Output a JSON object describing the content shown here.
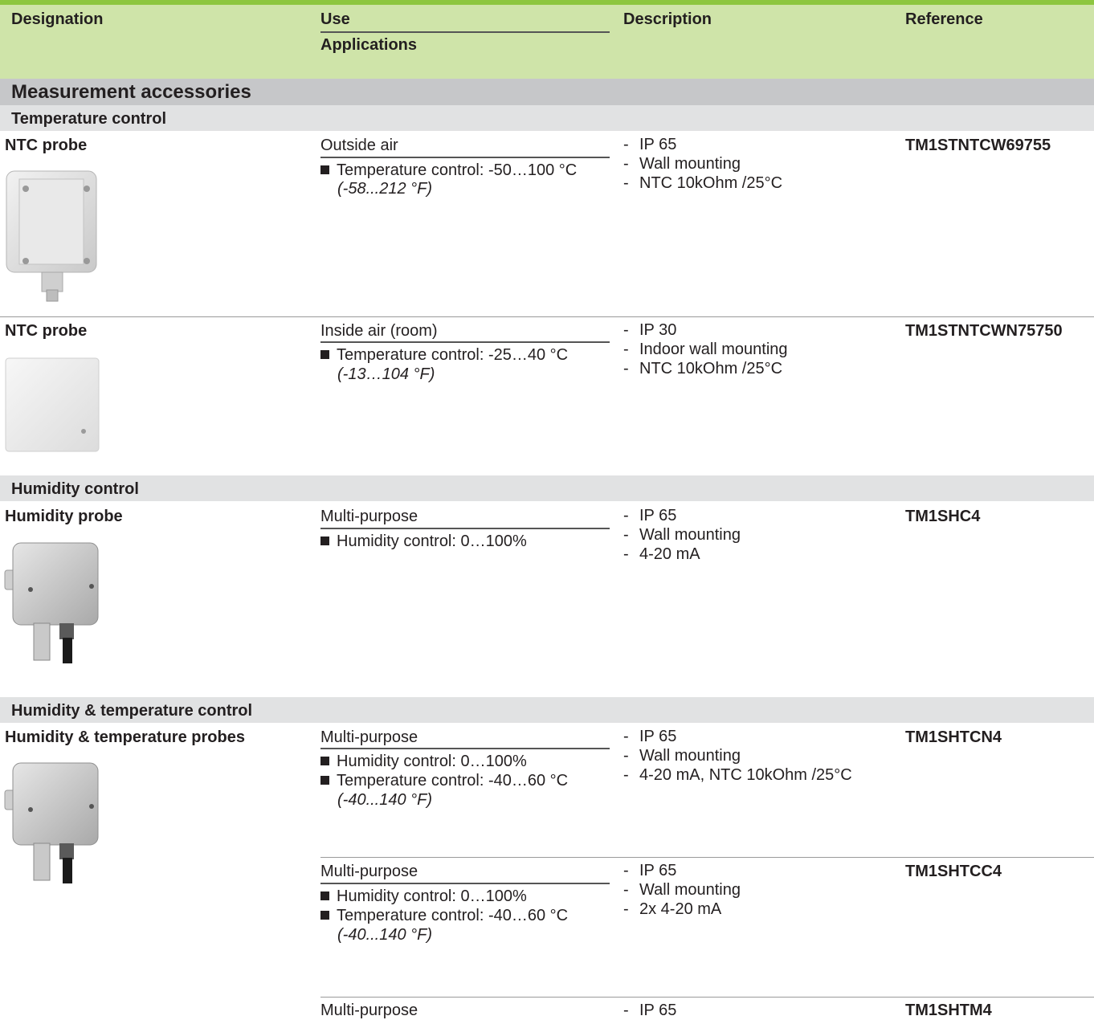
{
  "header": {
    "designation": "Designation",
    "use": "Use",
    "applications": "Applications",
    "description": "Description",
    "reference": "Reference"
  },
  "section": {
    "title": "Measurement accessories"
  },
  "groups": {
    "temperature": "Temperature control",
    "humidity": "Humidity control",
    "humtemp": "Humidity & temperature control"
  },
  "rows": [
    {
      "designation": "NTC probe",
      "use": "Outside air",
      "bullets": [
        "Temperature control: -50…100 °C"
      ],
      "italic": "(-58...212 °F)",
      "desc": [
        "IP 65",
        "Wall mounting",
        "NTC 10kOhm /25°C"
      ],
      "reference": "TM1STNTCW69755"
    },
    {
      "designation": "NTC probe",
      "use": "Inside air (room)",
      "bullets": [
        "Temperature control: -25…40 °C"
      ],
      "italic": "(-13…104 °F)",
      "desc": [
        "IP 30",
        "Indoor wall mounting",
        "NTC 10kOhm /25°C"
      ],
      "reference": "TM1STNTCWN75750"
    },
    {
      "designation": "Humidity probe",
      "use": "Multi-purpose",
      "bullets": [
        "Humidity control: 0…100%"
      ],
      "desc": [
        "IP 65",
        "Wall mounting",
        "4-20 mA"
      ],
      "reference": "TM1SHC4"
    },
    {
      "designation": "Humidity & temperature probes",
      "use": "Multi-purpose",
      "bullets": [
        "Humidity control: 0…100%",
        "Temperature control: -40…60 °C"
      ],
      "italic": "(-40...140 °F)",
      "desc": [
        "IP 65",
        "Wall mounting",
        "4-20 mA, NTC 10kOhm /25°C"
      ],
      "reference": "TM1SHTCN4"
    },
    {
      "use": "Multi-purpose",
      "bullets": [
        "Humidity control: 0…100%",
        "Temperature control: -40…60 °C"
      ],
      "italic": "(-40...140 °F)",
      "desc": [
        "IP 65",
        "Wall mounting",
        "2x  4-20 mA"
      ],
      "reference": "TM1SHTCC4"
    },
    {
      "use": "Multi-purpose",
      "desc": [
        "IP 65"
      ],
      "reference": "TM1SHTM4"
    }
  ],
  "icons": [
    "bullet-square-icon"
  ],
  "colors": {
    "header_bg": "#cfe4a9",
    "header_accent": "#8dc63f",
    "section_bg": "#c6c7c9",
    "group_bg": "#e1e2e3"
  }
}
